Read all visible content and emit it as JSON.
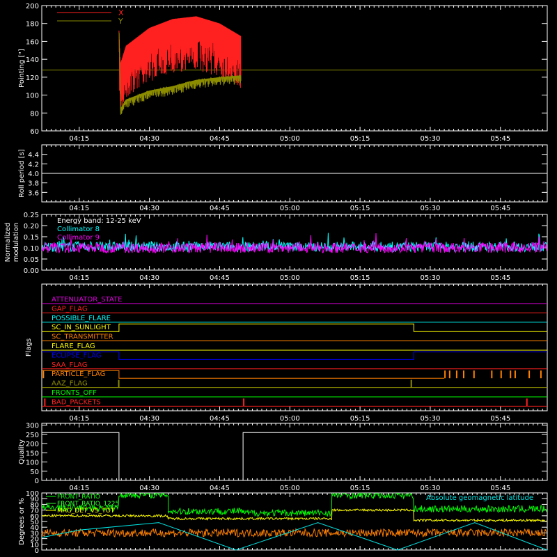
{
  "colors": {
    "background": "#000000",
    "axes": "#ffffff",
    "x_pointing": "#ff2020",
    "y_pointing": "#8c8c00",
    "roll": "#ffffff",
    "collimator_8": "#00ffff",
    "collimator_9": "#ff00ff",
    "front_ratio": "#00ff00",
    "front_ratio_1225": "#33ff33",
    "mag_det_vs_tot": "#ffff00",
    "geomag_lat": "#00e5e5",
    "orange_trace": "#ff8000"
  },
  "time_axis": {
    "range_minutes": [
      0,
      100
    ],
    "tick_labels": [
      "04:15",
      "04:30",
      "04:45",
      "05:00",
      "05:15",
      "05:30",
      "05:45"
    ],
    "tick_minutes": [
      0,
      15,
      30,
      45,
      60,
      75,
      90
    ]
  },
  "chart_data": [
    {
      "type": "line",
      "ylabel": "Pointing [\"]",
      "ylim": [
        60,
        200
      ],
      "yticks": [
        "60",
        "80",
        "100",
        "120",
        "140",
        "160",
        "180",
        "200"
      ],
      "legend_placement": "top-left",
      "series": [
        {
          "name": "X",
          "x": [
            8.5,
            8.8,
            10,
            15,
            20,
            25,
            30,
            34.5
          ],
          "values": [
            170,
            85,
            95,
            105,
            110,
            117,
            120,
            122
          ],
          "scatter_low": 12
        },
        {
          "name": "Y",
          "x": [
            8.5,
            8.8,
            10,
            15,
            20,
            25,
            30,
            34.5
          ],
          "values": [
            172,
            135,
            155,
            175,
            185,
            188,
            180,
            166
          ],
          "scatter_low": 60
        }
      ],
      "constant_line": {
        "value": 128,
        "color_key": "y_pointing"
      }
    },
    {
      "type": "line",
      "ylabel": "Roll period [s]",
      "ylim": [
        3.4,
        4.6
      ],
      "yticks": [
        "3.6",
        "3.8",
        "4.0",
        "4.2",
        "4.4"
      ],
      "series": [
        {
          "name": "",
          "x": [
            -8,
            100
          ],
          "values": [
            4.0,
            4.0
          ]
        }
      ]
    },
    {
      "type": "line",
      "ylabel_lines": [
        "Normalized",
        "modulation"
      ],
      "ylim": [
        0,
        0.25
      ],
      "yticks": [
        "0.00",
        "0.05",
        "0.10",
        "0.15",
        "0.20",
        "0.25"
      ],
      "annotation": "Energy band: 12-25 keV",
      "series": [
        {
          "name": "Collimator 8",
          "mean": 0.105,
          "spread": 0.03
        },
        {
          "name": "Collimator 9",
          "mean": 0.1,
          "spread": 0.03
        }
      ]
    },
    {
      "type": "line",
      "ylabel": "Flags",
      "flags": [
        {
          "name": "ATTENUATOR_STATE",
          "color": "#e000e0",
          "segments": [
            [
              -8,
              100,
              0
            ]
          ]
        },
        {
          "name": "GAP_FLAG",
          "color": "#ff2020",
          "segments": [
            [
              -8,
              100,
              0
            ]
          ]
        },
        {
          "name": "POSSIBLE_FLARE",
          "color": "#00ffff",
          "segments": [
            [
              -8,
              100,
              0
            ]
          ]
        },
        {
          "name": "SC_IN_SUNLIGHT",
          "color": "#ffff00",
          "segments": [
            [
              -8,
              8.5,
              0
            ],
            [
              8.5,
              71.5,
              1
            ],
            [
              71.5,
              100,
              0
            ]
          ]
        },
        {
          "name": "SC_TRANSMITTER",
          "color": "#ff8000",
          "segments": [
            [
              -8,
              100,
              0
            ]
          ]
        },
        {
          "name": "FLARE_FLAG",
          "color": "#ffff00",
          "segments": [
            [
              -8,
              100,
              0
            ]
          ]
        },
        {
          "name": "ECLIPSE_FLAG",
          "color": "#0000ff",
          "segments": [
            [
              -8,
              8.5,
              1
            ],
            [
              8.5,
              71.5,
              0
            ],
            [
              71.5,
              100,
              1
            ]
          ]
        },
        {
          "name": "SAA_FLAG",
          "color": "#ff2020",
          "segments": [
            [
              -8,
              100,
              0
            ]
          ]
        },
        {
          "name": "PARTICLE_FLAG",
          "color": "#ff8000",
          "segments": [
            [
              -8,
              8.5,
              1
            ],
            [
              8.5,
              78,
              0
            ]
          ],
          "spikes": [
            -7.8,
            78,
            79,
            80.5,
            82,
            84.2,
            88,
            90,
            92,
            93,
            96,
            98.5
          ]
        },
        {
          "name": "AAZ_FLAG",
          "color": "#8c8c00",
          "segments": [
            [
              -8,
              100,
              0
            ]
          ],
          "spikes": [
            8.3,
            70.8
          ]
        },
        {
          "name": "FRONTS_OFF",
          "color": "#00ff00",
          "segments": [
            [
              -8,
              100,
              0
            ]
          ]
        },
        {
          "name": "BAD_PACKETS",
          "color": "#ff2020",
          "segments": [
            [
              -8,
              100,
              0
            ]
          ],
          "spikes": [
            -7.5,
            35,
            95.5
          ]
        }
      ]
    },
    {
      "type": "line",
      "ylabel": "Quality",
      "ylim": [
        0,
        310
      ],
      "yticks": [
        "0",
        "50",
        "100",
        "150",
        "200",
        "250",
        "300"
      ],
      "series": [
        {
          "name": "",
          "x": [
            -8,
            8.5,
            8.5,
            35,
            35,
            100
          ],
          "values": [
            260,
            260,
            0,
            0,
            260,
            260
          ]
        }
      ]
    },
    {
      "type": "line",
      "ylabel": "Degrees or %",
      "ylim": [
        0,
        100
      ],
      "yticks": [
        "0",
        "10",
        "20",
        "30",
        "40",
        "50",
        "60",
        "70",
        "80",
        "90",
        "100"
      ],
      "legend_entries": [
        {
          "label": "FRONT_RATIO",
          "color_key": "front_ratio"
        },
        {
          "label": "FRONT_RATIO_1225",
          "color_key": "front_ratio_1225"
        },
        {
          "label": "MAG_DET_VS_TOT",
          "color_key": "mag_det_vs_tot"
        }
      ],
      "annotation": "Absolute geomagnetic latitude",
      "series": [
        {
          "name": "FRONT_RATIO",
          "levels": [
            [
              -8,
              8.5,
              74
            ],
            [
              8.5,
              19,
              97
            ],
            [
              19,
              35,
              68
            ],
            [
              35,
              54,
              65
            ],
            [
              54,
              71.5,
              96
            ],
            [
              71.5,
              100,
              72
            ]
          ],
          "noise": 6
        },
        {
          "name": "MAG_DET_VS_TOT",
          "levels": [
            [
              -8,
              19,
              60
            ],
            [
              19,
              54,
              55
            ],
            [
              54,
              71.5,
              70
            ],
            [
              71.5,
              100,
              52
            ]
          ],
          "noise": 2
        },
        {
          "name": "Absolute geomagnetic latitude",
          "x": [
            -8,
            0,
            17,
            33.5,
            51,
            68,
            84.5,
            100
          ],
          "values": [
            22,
            35,
            48,
            0,
            48,
            0,
            48,
            0
          ]
        },
        {
          "name": "",
          "mean": 30,
          "noise": 7
        }
      ]
    }
  ]
}
